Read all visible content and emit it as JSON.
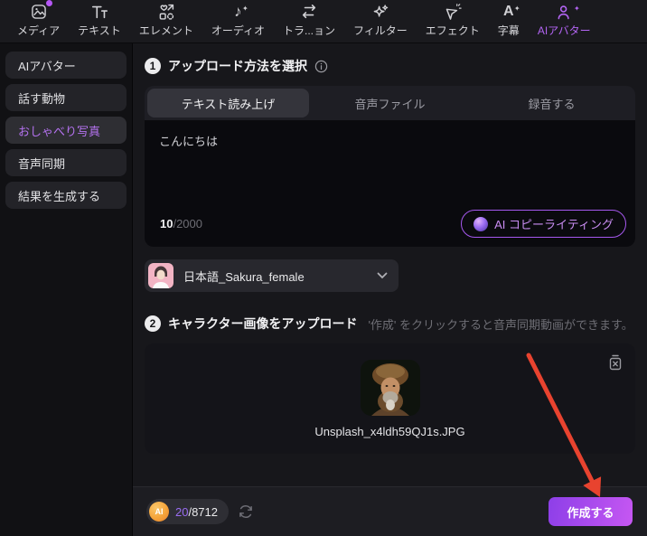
{
  "colors": {
    "accent_purple": "#b264f2",
    "create_gradient_start": "#8d3fe8",
    "create_gradient_end": "#c657f2",
    "arrow_red": "#e8432f",
    "ai_coin_orange": "#f5a43a"
  },
  "toolbar": {
    "items": [
      {
        "label": "メディア",
        "icon": "media-icon",
        "active": false
      },
      {
        "label": "テキスト",
        "icon": "text-icon",
        "active": false
      },
      {
        "label": "エレメント",
        "icon": "elements-icon",
        "active": false
      },
      {
        "label": "オーディオ",
        "icon": "audio-icon",
        "active": false
      },
      {
        "label": "トラ...ョン",
        "icon": "transition-icon",
        "active": false
      },
      {
        "label": "フィルター",
        "icon": "filter-icon",
        "active": false
      },
      {
        "label": "エフェクト",
        "icon": "effects-icon",
        "active": false
      },
      {
        "label": "字幕",
        "icon": "subtitle-icon",
        "active": false
      },
      {
        "label": "AIアバター",
        "icon": "ai-avatar-icon",
        "active": true
      }
    ]
  },
  "sidebar": {
    "items": [
      {
        "label": "AIアバター",
        "active": false
      },
      {
        "label": "話す動物",
        "active": false
      },
      {
        "label": "おしゃべり写真",
        "active": true
      },
      {
        "label": "音声同期",
        "active": false
      },
      {
        "label": "結果を生成する",
        "active": false
      }
    ]
  },
  "main": {
    "step1": {
      "number": "1",
      "title": "アップロード方法を選択",
      "tabs": [
        {
          "label": "テキスト読み上げ",
          "active": true
        },
        {
          "label": "音声ファイル",
          "active": false
        },
        {
          "label": "録音する",
          "active": false
        }
      ],
      "textarea": {
        "value": "こんにちは",
        "char_count": "10",
        "char_limit": "/2000"
      },
      "ai_copywriting_button": "AI コピーライティング",
      "voice_select": {
        "value": "日本語_Sakura_female"
      }
    },
    "step2": {
      "number": "2",
      "title": "キャラクター画像をアップロード",
      "hint": "'作成' をクリックすると音声同期動画ができます。",
      "file_name": "Unsplash_x4ldh59QJ1s.JPG"
    },
    "footer": {
      "ai_badge": "AI",
      "credits_used": "20",
      "credits_total": "/8712",
      "create_button": "作成する"
    }
  }
}
